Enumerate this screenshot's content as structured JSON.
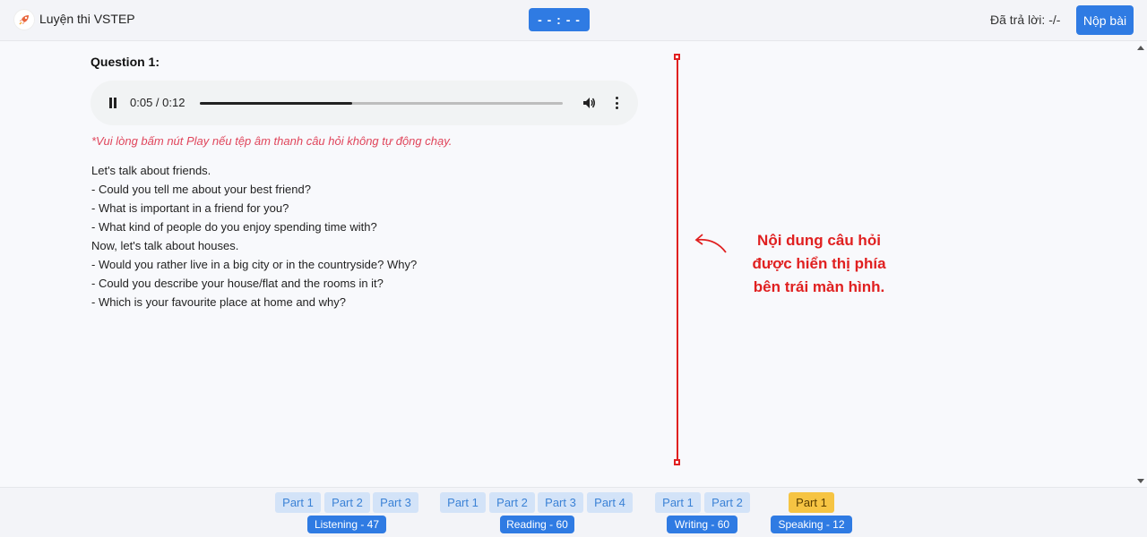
{
  "header": {
    "app_title": "Luyện thi VSTEP",
    "timer": "- - : - -",
    "answered": "Đã trả lời: -/-",
    "submit_label": "Nộp bài",
    "logo_icon": "rocket-icon"
  },
  "question": {
    "title": "Question 1:",
    "audio": {
      "time": "0:05 / 0:12",
      "progress": 0.42
    },
    "note": "*Vui lòng bấm nút Play nếu tệp âm thanh câu hỏi không tự động chạy.",
    "lines": [
      "Let's talk about friends.",
      "- Could you tell me about your best friend?",
      "- What is important in a friend for you?",
      "- What kind of people do you enjoy spending time with?",
      "Now, let's talk about houses.",
      "- Would you rather live in a big city or in the countryside? Why?",
      "- Could you describe your house/flat and the rooms in it?",
      "- Which is your favourite place at home and why?"
    ]
  },
  "annotation": {
    "line1": "Nội dung câu hỏi",
    "line2": "được hiển thị phía",
    "line3": "bên trái màn hình.",
    "color": "#e02020"
  },
  "footer": {
    "listening": {
      "label": "Listening - 47",
      "parts": [
        "Part 1",
        "Part 2",
        "Part 3"
      ]
    },
    "reading": {
      "label": "Reading - 60",
      "parts": [
        "Part 1",
        "Part 2",
        "Part 3",
        "Part 4"
      ]
    },
    "writing": {
      "label": "Writing - 60",
      "parts": [
        "Part 1",
        "Part 2"
      ]
    },
    "speaking": {
      "label": "Speaking - 12",
      "parts": [
        "Part 1"
      ]
    }
  },
  "colors": {
    "primary": "#2f7be3",
    "part_bg": "#d3e3f8",
    "active_part": "#f6c443",
    "note": "#e0455b"
  }
}
